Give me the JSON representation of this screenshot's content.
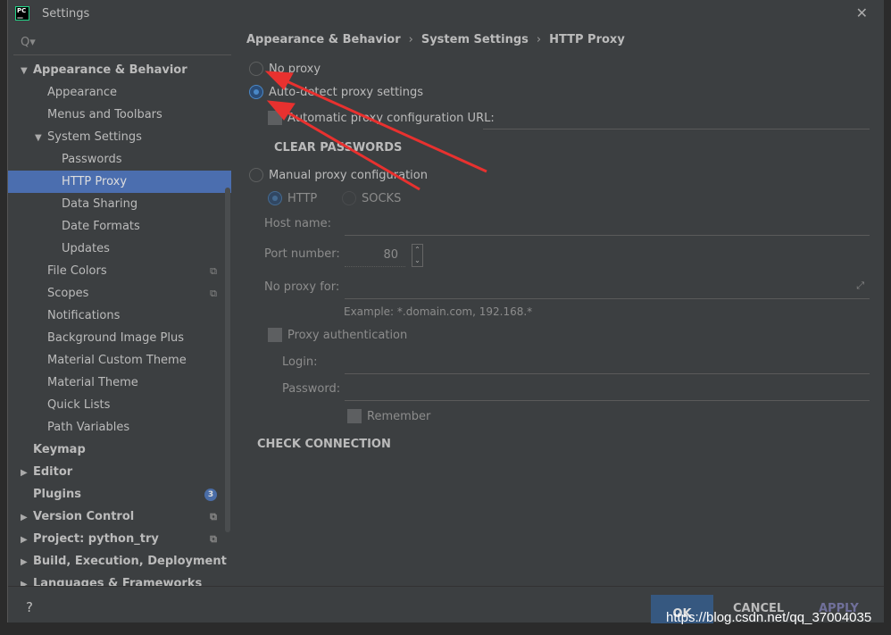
{
  "window": {
    "title": "Settings",
    "logo": "PC"
  },
  "search": {
    "placeholder": "Q▾"
  },
  "sidebar": {
    "items": [
      {
        "label": "Appearance & Behavior",
        "level": 0,
        "bold": true,
        "arrow": "▼"
      },
      {
        "label": "Appearance",
        "level": 1
      },
      {
        "label": "Menus and Toolbars",
        "level": 1
      },
      {
        "label": "System Settings",
        "level": 1,
        "arrow": "▼"
      },
      {
        "label": "Passwords",
        "level": 2
      },
      {
        "label": "HTTP Proxy",
        "level": 2,
        "selected": true
      },
      {
        "label": "Data Sharing",
        "level": 2
      },
      {
        "label": "Date Formats",
        "level": 2
      },
      {
        "label": "Updates",
        "level": 2
      },
      {
        "label": "File Colors",
        "level": 1,
        "icon": "copy-icon"
      },
      {
        "label": "Scopes",
        "level": 1,
        "icon": "copy-icon"
      },
      {
        "label": "Notifications",
        "level": 1
      },
      {
        "label": "Background Image Plus",
        "level": 1
      },
      {
        "label": "Material Custom Theme",
        "level": 1
      },
      {
        "label": "Material Theme",
        "level": 1
      },
      {
        "label": "Quick Lists",
        "level": 1
      },
      {
        "label": "Path Variables",
        "level": 1
      },
      {
        "label": "Keymap",
        "level": 0,
        "bold": true
      },
      {
        "label": "Editor",
        "level": 0,
        "bold": true,
        "arrow": "▶"
      },
      {
        "label": "Plugins",
        "level": 0,
        "bold": true,
        "badge": "3"
      },
      {
        "label": "Version Control",
        "level": 0,
        "bold": true,
        "arrow": "▶",
        "icon": "copy-icon"
      },
      {
        "label": "Project: python_try",
        "level": 0,
        "bold": true,
        "arrow": "▶",
        "icon": "copy-icon"
      },
      {
        "label": "Build, Execution, Deployment",
        "level": 0,
        "bold": true,
        "arrow": "▶"
      },
      {
        "label": "Languages & Frameworks",
        "level": 0,
        "bold": true,
        "arrow": "▶"
      }
    ]
  },
  "breadcrumb": [
    "Appearance & Behavior",
    "System Settings",
    "HTTP Proxy"
  ],
  "proxy": {
    "no_proxy": "No proxy",
    "auto_detect": "Auto-detect proxy settings",
    "auto_url": "Automatic proxy configuration URL:",
    "clear_passwords": "CLEAR PASSWORDS",
    "manual": "Manual proxy configuration",
    "http": "HTTP",
    "socks": "SOCKS",
    "host_label": "Host name:",
    "port_label": "Port number:",
    "port_value": "80",
    "no_proxy_for": "No proxy for:",
    "example": "Example: *.domain.com, 192.168.*",
    "proxy_auth": "Proxy authentication",
    "login": "Login:",
    "password": "Password:",
    "remember": "Remember",
    "check_connection": "CHECK CONNECTION",
    "selected": "auto_detect"
  },
  "footer": {
    "help": "?",
    "ok": "OK",
    "cancel": "CANCEL",
    "apply": "APPLY"
  },
  "watermark": "https://blog.csdn.net/qq_37004035",
  "colors": {
    "selection": "#4b6eaf",
    "background": "#3c3f41",
    "annotation_arrow": "#e8312f"
  }
}
